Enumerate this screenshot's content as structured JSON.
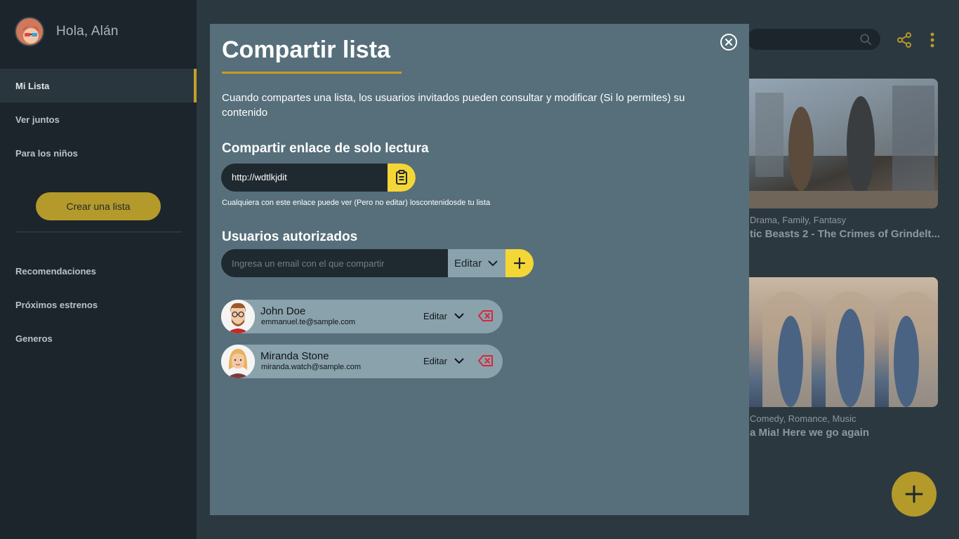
{
  "sidebar": {
    "greeting": "Hola, Alán",
    "nav_primary": [
      {
        "label": "Mi Lista",
        "active": true
      },
      {
        "label": "Ver juntos",
        "active": false
      },
      {
        "label": "Para los niños",
        "active": false
      }
    ],
    "create_list_label": "Crear una lista",
    "nav_secondary": [
      {
        "label": "Recomendaciones"
      },
      {
        "label": "Próximos estrenos"
      },
      {
        "label": "Generos"
      }
    ]
  },
  "header": {
    "search_icon": "search-icon",
    "share_icon": "share-icon",
    "menu_icon": "kebab-menu-icon"
  },
  "background_cards": [
    {
      "genres": "Drama, Family, Fantasy",
      "title": "tic Beasts 2 - The Crimes of Grindelt..."
    },
    {
      "genres": "Comedy, Romance, Music",
      "title": "a Mia! Here we go again"
    }
  ],
  "modal": {
    "title": "Compartir lista",
    "description": "Cuando compartes una lista, los usuarios invitados pueden consultar y modificar (Si lo permites) su contenido",
    "readonly_section_title": "Compartir enlace de solo lectura",
    "readonly_link": "http://wdtlkjdit",
    "readonly_hint": "Cualquiera con este enlace puede ver (Pero no editar) loscontenidosde tu lista",
    "users_section_title": "Usuarios autorizados",
    "email_placeholder": "Ingresa un email con el que compartir",
    "permission_selected": "Editar",
    "users": [
      {
        "name": "John Doe",
        "email": "emmanuel.te@sample.com",
        "permission": "Editar"
      },
      {
        "name": "Miranda Stone",
        "email": "miranda.watch@sample.com",
        "permission": "Editar"
      }
    ]
  },
  "colors": {
    "accent_yellow": "#f5d637",
    "accent_gold": "#b39a2a",
    "modal_bg": "#566f7b",
    "sidebar_bg": "#1c252b",
    "remove_red": "#d6283c"
  }
}
